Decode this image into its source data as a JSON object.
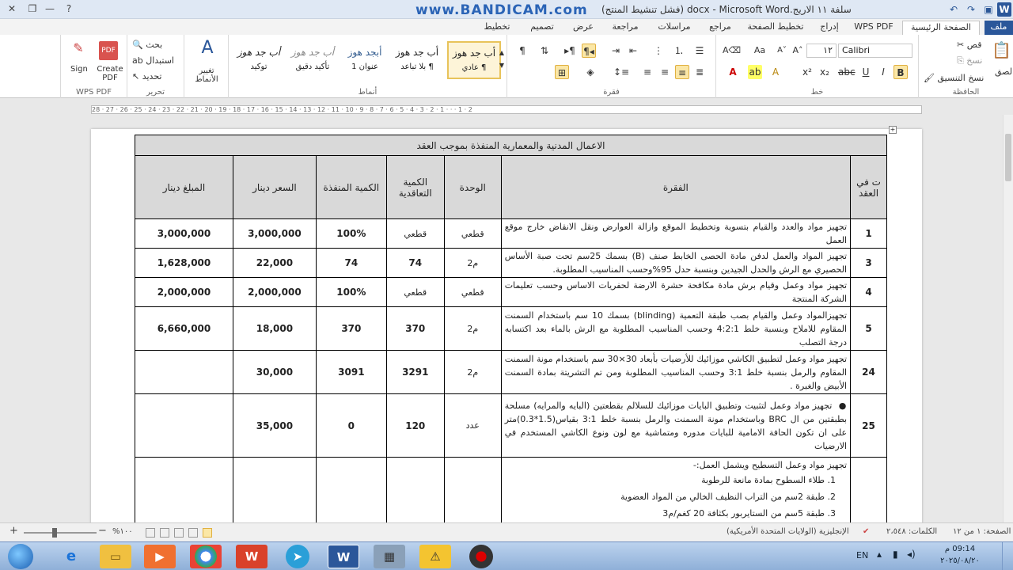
{
  "window": {
    "title": "سلفة ١١ الاريج.docx - Microsoft Word (فشل تنشيط المنتج)",
    "watermark": "www.BANDICAM.com",
    "controls": {
      "minimize": "—",
      "maximize": "❐",
      "close": "✕",
      "help": "?"
    }
  },
  "tabs": [
    {
      "label": "ملف"
    },
    {
      "label": "الصفحة الرئيسية"
    },
    {
      "label": "WPS PDF"
    },
    {
      "label": "إدراج"
    },
    {
      "label": "تخطيط الصفحة"
    },
    {
      "label": "مراجع"
    },
    {
      "label": "مراسلات"
    },
    {
      "label": "مراجعة"
    },
    {
      "label": "عرض"
    },
    {
      "label": "تصميم"
    },
    {
      "label": "تخطيط"
    }
  ],
  "ribbon": {
    "clipboard": {
      "label": "الحافظة",
      "paste": "لصق",
      "cut": "قص",
      "copy": "نسخ",
      "format_painter": "نسخ التنسيق"
    },
    "font": {
      "label": "خط",
      "font_name": "Calibri",
      "font_size": "١٢",
      "bold": "B",
      "italic": "I",
      "underline": "U"
    },
    "paragraph": {
      "label": "فقرة"
    },
    "styles": {
      "label": "أنماط",
      "items": [
        {
          "preview": "أب جد هوز",
          "name": "¶ عادي"
        },
        {
          "preview": "أب جد هوز",
          "name": "¶ بلا تباعد"
        },
        {
          "preview": "أبجد هوز",
          "name": "عنوان 1"
        },
        {
          "preview": "أب جد هوز",
          "name": "تأكيد دقيق"
        },
        {
          "preview": "أب جد هوز",
          "name": "توكيد"
        }
      ],
      "change_styles": "تغيير الأنماط"
    },
    "editing": {
      "label": "تحرير",
      "find": "بحث",
      "replace": "استبدال",
      "select": "تحديد"
    },
    "wps_pdf": {
      "label": "WPS PDF",
      "create_pdf": "Create PDF",
      "sign": "Sign"
    }
  },
  "ruler": {
    "ticks": "28 · 27 · 26 · 25 · 24 · 23 · 22 · 21 · 20 · 19 · 18 · 17 · 16 · 15 · 14 · 13 · 12 · 11 · 10 · 9 · 8 · 7 · 6 · 5 · 4 · 3 · 2 · 1 · · · 1 · 2"
  },
  "table": {
    "caption": "الاعمال المدنية والمعمارية المنفذة بموجب العقد",
    "headers": {
      "seq": "ت في العقد",
      "item": "الفقرة",
      "unit": "الوحدة",
      "contract_qty": "الكمية التعاقدية",
      "executed_qty": "الكمية المنفذة",
      "price": "السعر دينار",
      "amount": "المبلغ دينار"
    },
    "rows": [
      {
        "seq": "1",
        "desc": "تجهيز مواد والعدد والقيام بتسوية وتخطيط الموقع وازالة العوارض ونقل الانقاض خارج موقع العمل",
        "unit": "قطعي",
        "contract_qty": "قطعي",
        "executed_qty": "100%",
        "price": "3,000,000",
        "amount": "3,000,000"
      },
      {
        "seq": "3",
        "desc": "تجهيز المواد والعمل لدفن مادة الحصى الخابط صنف (B) بسمك 25سم تحت صبة الأساس الحصيري مع الرش والحدل الجيدين وبنسبة حدل 95%وحسب المناسيب المطلوبة.",
        "unit": "م2",
        "contract_qty": "74",
        "executed_qty": "74",
        "price": "22,000",
        "amount": "1,628,000"
      },
      {
        "seq": "4",
        "desc": "تجهيز مواد وعمل وقيام برش مادة مكافحة حشرة الارضة لحفريات الاساس وحسب تعليمات الشركة المنتجة",
        "unit": "قطعي",
        "contract_qty": "قطعي",
        "executed_qty": "100%",
        "price": "2,000,000",
        "amount": "2,000,000"
      },
      {
        "seq": "5",
        "desc": "تجهيزالمواد وعمل والقيام بصب طبقة التعمية (blinding) بسمك 10 سم باستخدام السمنت المقاوم للاملاح وبنسبة خلط 4:2:1 وحسب المناسيب المطلوبة مع الرش بالماء بعد اكتسابه درجة التصلب",
        "unit": "م2",
        "contract_qty": "370",
        "executed_qty": "370",
        "price": "18,000",
        "amount": "6,660,000"
      },
      {
        "seq": "24",
        "desc": "تجهيز مواد وعمل لتطبيق الكاشي موزائيك للأرضيات بأبعاد 30×30 سم باستخدام مونة السمنت المقاوم والرمل بنسبة خلط 3:1 وحسب المناسيب المطلوبة ومن تم التشريتة بمادة السمنت الأبيض والغبرة .",
        "unit": "م2",
        "contract_qty": "3291",
        "executed_qty": "3091",
        "price": "30,000",
        "amount": ""
      },
      {
        "seq": "25",
        "desc": "تجهيز مواد وعمل لتثبيت وتطبيق البايات موزائيك للسلالم بقطعتين (البايه والمرايه) مسلحة بطبقتين من ال BRC وباستخدام مونة السمنت والرمل بنسبة خلط 3:1 بقياس(1.5*0.3)متر على ان تكون الحافة الامامية للبايات مدوره ومتماشية مع لون ونوع الكاشي المستخدم في الارضيات",
        "unit": "عدد",
        "contract_qty": "120",
        "executed_qty": "0",
        "price": "35,000",
        "amount": ""
      }
    ],
    "last_row": {
      "intro": "تجهيز مواد وعمل التسطيح ويشمل العمل:-",
      "items": [
        "1.   طلاء السطوح بمادة مانعة للرطوبة",
        "2.   طبقة 2سم من التراب النظيف الخالي من المواد العضوية",
        "3.   طبقة 5سم من الستايربور بكثافة 20 كغم/م3"
      ]
    }
  },
  "status": {
    "page": "الصفحة: ١ من ١٢",
    "words": "الكلمات: ٢،٥٤٨",
    "language": "الإنجليزية (الولايات المتحدة الأمريكية)",
    "zoom": "١٠٠%"
  },
  "taskbar": {
    "lang": "EN",
    "time": "09:14 م",
    "date": "٢٠٢٥/٠٨/٢٠"
  },
  "colors": {
    "file_tab": "#2b579a",
    "watermark": "#2b64b6",
    "table_header": "#d9d9d9"
  }
}
